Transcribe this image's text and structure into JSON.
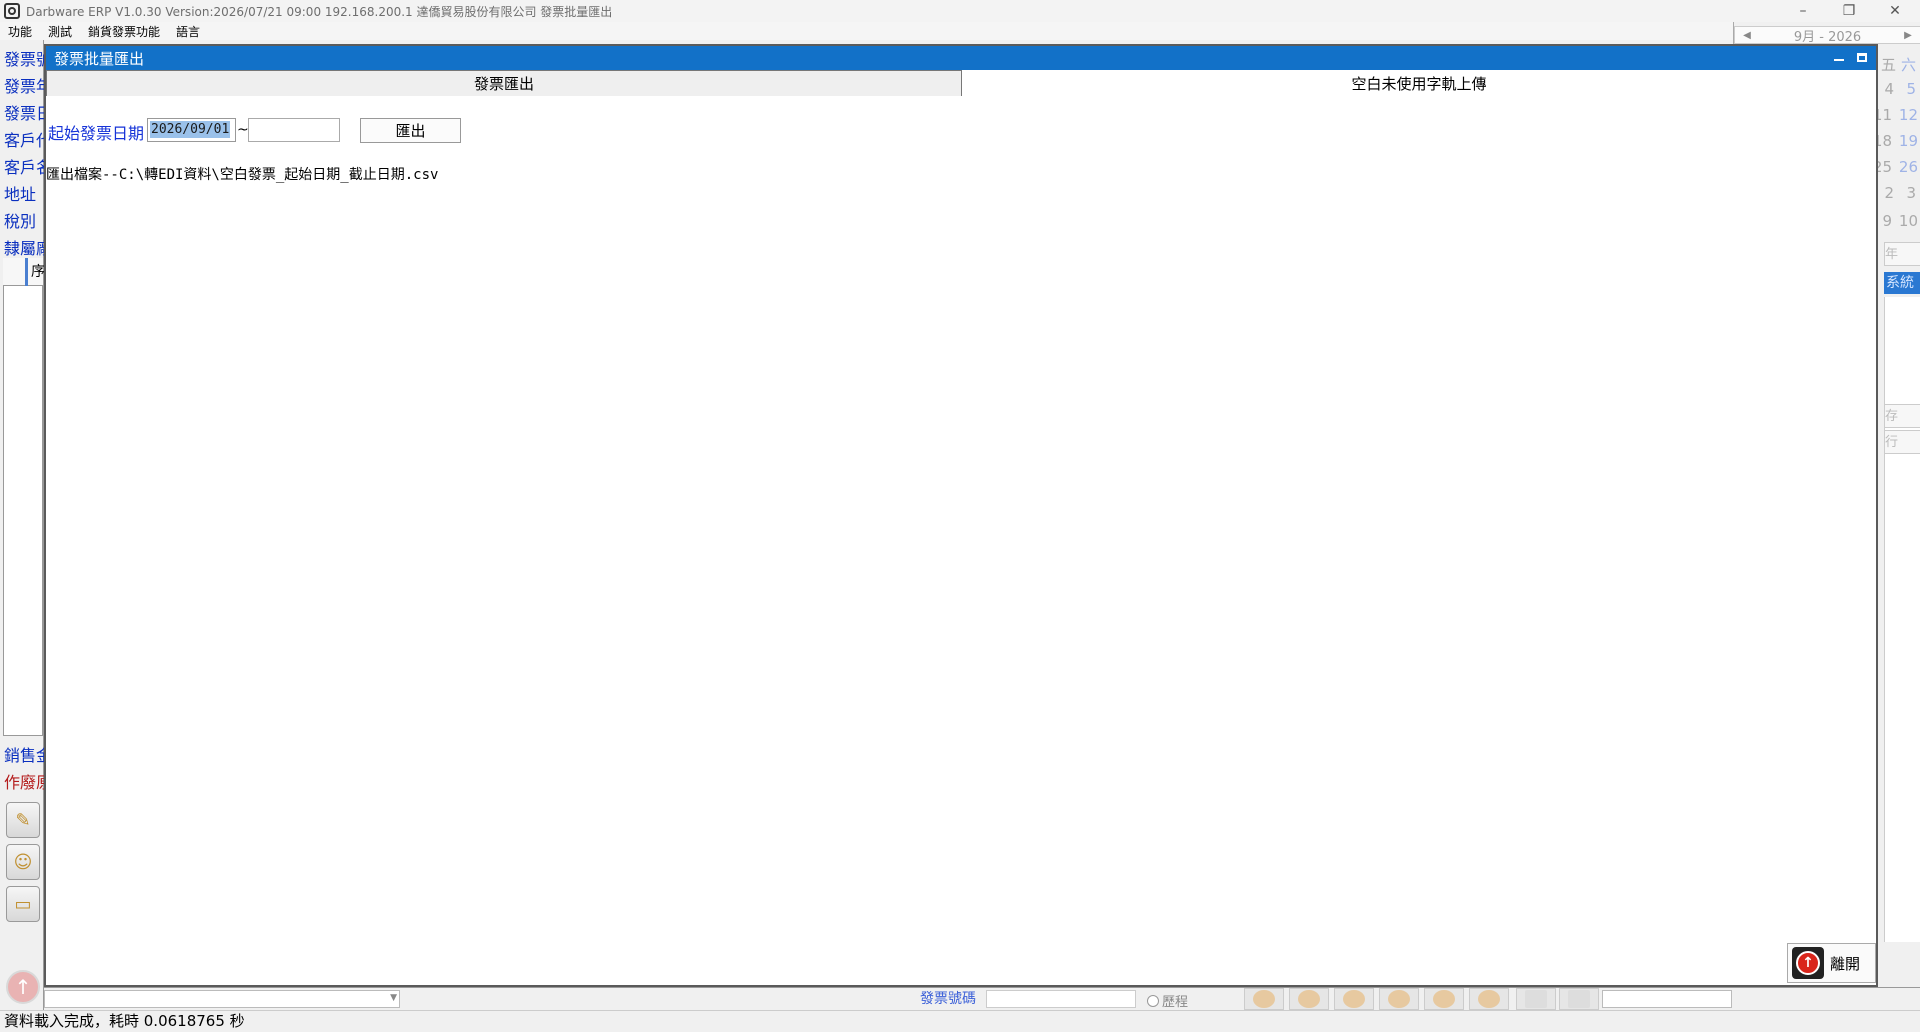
{
  "app": {
    "title": "Darbware ERP V1.0.30 Version:2026/07/21 09:00   192.168.200.1 達僑貿易股份有限公司 發票批量匯出",
    "minimize_glyph": "–",
    "restore_glyph": "❐",
    "close_glyph": "✕"
  },
  "menu": [
    "功能",
    "測試",
    "銷貨發票功能",
    "語言"
  ],
  "background": {
    "left_labels": [
      "發票號",
      "發票年",
      "發票日",
      "客戶代",
      "客戶名",
      "地址",
      "稅別",
      "隸屬廠"
    ],
    "left_labels_lower": [
      "銷售金",
      "作廢原"
    ],
    "grid_header": "序",
    "calendar_header": "9月 - 2026",
    "calendar_numbers": [
      "六",
      "5",
      "12",
      "19",
      "26",
      "3",
      "10"
    ],
    "calendar_left_fragments": [
      "五",
      "4",
      "11",
      "18",
      "25",
      "2",
      "9"
    ],
    "right_buttons": [
      "年",
      "存",
      "行"
    ],
    "system_button": "系統",
    "bottom_label": "發票號碼",
    "bottom_radio": "歷程"
  },
  "dialog": {
    "title": "發票批量匯出",
    "tabs": [
      "發票匯出",
      "空白未使用字軌上傳"
    ],
    "start_date_label": "起始發票日期",
    "date_from": "2026/09/01",
    "date_to": "",
    "tilde": "~",
    "export_button": "匯出",
    "export_note": "匯出檔案--C:\\轉EDI資料\\空白發票_起始日期_截止日期.csv",
    "leave_button": "離開"
  },
  "status": "資料載入完成，耗時 0.0618765 秒",
  "colors": {
    "dialog_titlebar": "#1271c8",
    "label_blue": "#1633d8",
    "selection": "#9ac1ea"
  }
}
